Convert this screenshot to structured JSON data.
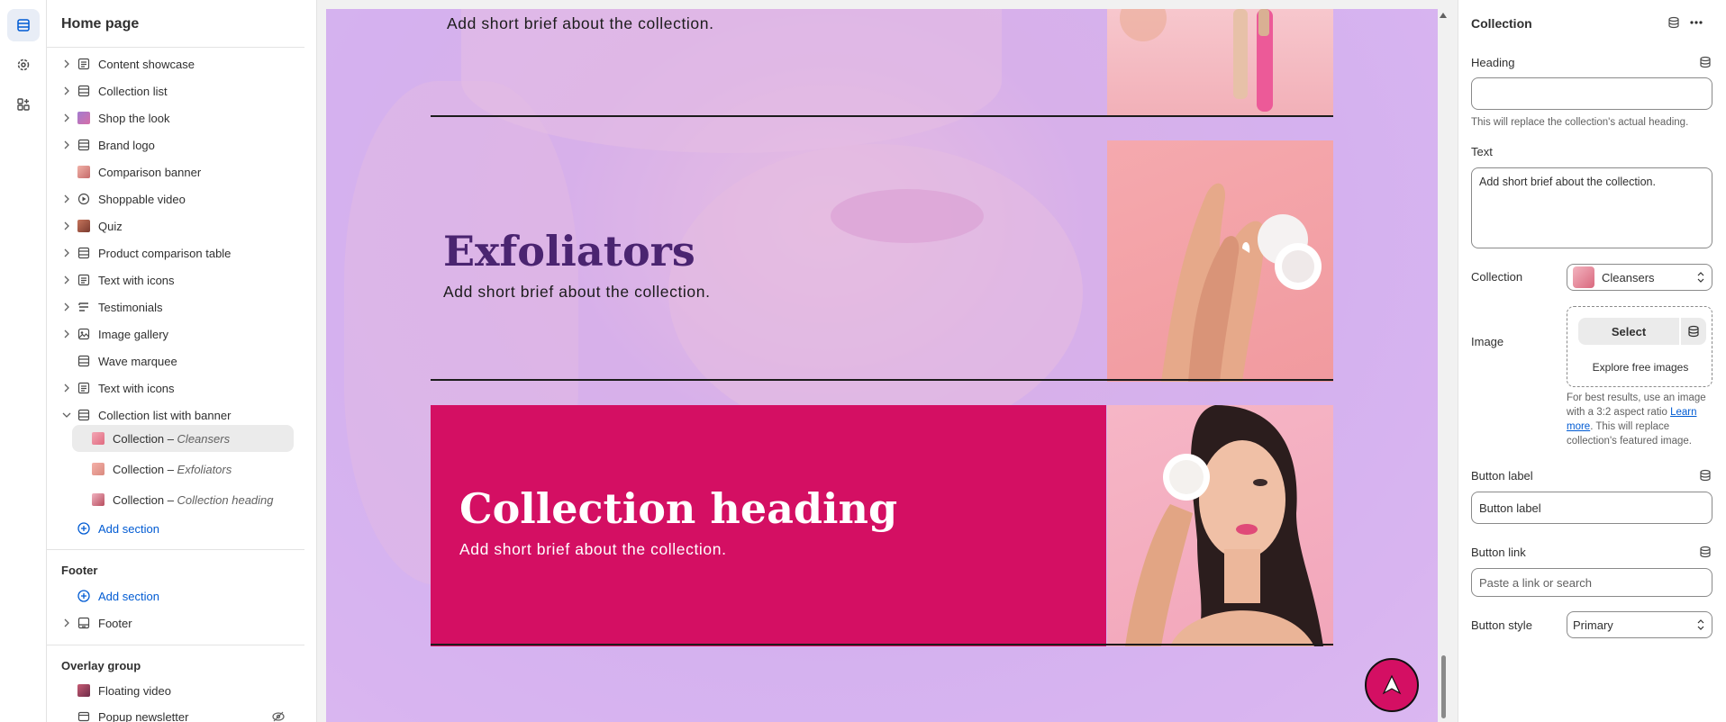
{
  "sidebar": {
    "title": "Home page",
    "sections": [
      {
        "label": "Content showcase",
        "icon": "text-section-icon"
      },
      {
        "label": "Collection list",
        "icon": "layout-section-icon"
      },
      {
        "label": "Shop the look",
        "icon": "image-thumb-icon"
      },
      {
        "label": "Brand logo",
        "icon": "layout-section-icon"
      },
      {
        "label": "Comparison banner",
        "icon": "image-thumb-icon"
      },
      {
        "label": "Shoppable video",
        "icon": "play-icon"
      },
      {
        "label": "Quiz",
        "icon": "image-thumb-icon"
      },
      {
        "label": "Product comparison table",
        "icon": "layout-section-icon"
      },
      {
        "label": "Text with icons",
        "icon": "text-section-icon"
      },
      {
        "label": "Testimonials",
        "icon": "list-section-icon"
      },
      {
        "label": "Image gallery",
        "icon": "gallery-icon"
      },
      {
        "label": "Wave marquee",
        "icon": "layout-section-icon"
      },
      {
        "label": "Text with icons",
        "icon": "text-section-icon"
      },
      {
        "label": "Collection list with banner",
        "icon": "layout-section-icon"
      }
    ],
    "blocks": [
      {
        "prefix": "Collection – ",
        "name": "Cleansers"
      },
      {
        "prefix": "Collection – ",
        "name": "Exfoliators"
      },
      {
        "prefix": "Collection – ",
        "name": "Collection heading"
      }
    ],
    "add_section": "Add section",
    "footer_title": "Footer",
    "footer_add": "Add section",
    "footer_item": "Footer",
    "overlay_title": "Overlay group",
    "overlay_items": [
      "Floating video",
      "Popup newsletter"
    ]
  },
  "preview": {
    "card1_text": "Add short brief about the collection.",
    "card2_heading": "Exfoliators",
    "card2_text": "Add short brief about the collection.",
    "card3_heading": "Collection heading",
    "card3_text": "Add short brief about the collection.",
    "accent": "#d40f63",
    "heading_color": "#4a2470"
  },
  "panel": {
    "title": "Collection",
    "heading_label": "Heading",
    "heading_value": "",
    "heading_help": "This will replace the collection's actual heading.",
    "text_label": "Text",
    "text_value": "Add short brief about the collection.",
    "collection_label": "Collection",
    "collection_value": "Cleansers",
    "image_label": "Image",
    "select_button": "Select",
    "explore_link": "Explore free images",
    "image_help_1": "For best results, use an image with a 3:2 aspect ratio",
    "image_help_link": "Learn more",
    "image_help_2": ". This will replace collection's featured image.",
    "button_label_label": "Button label",
    "button_label_value": "Button label",
    "button_link_label": "Button link",
    "button_link_placeholder": "Paste a link or search",
    "button_style_label": "Button style",
    "button_style_value": "Primary"
  }
}
